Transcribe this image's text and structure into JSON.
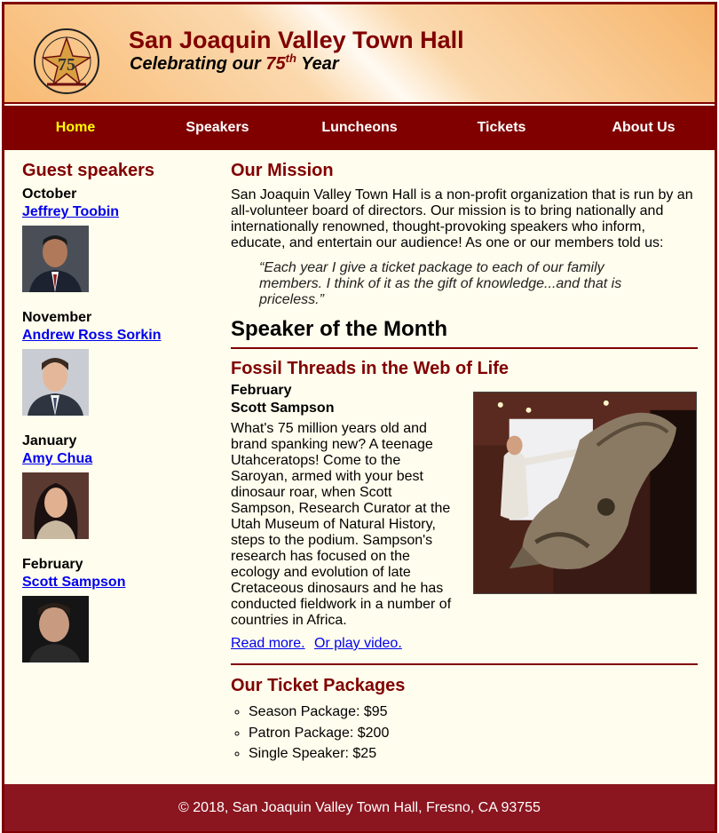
{
  "header": {
    "title": "San Joaquin Valley Town Hall",
    "tagline_prefix": "Celebrating our ",
    "tagline_number": "75",
    "tagline_sup": "th",
    "tagline_suffix": " Year"
  },
  "nav": {
    "items": [
      {
        "label": "Home"
      },
      {
        "label": "Speakers"
      },
      {
        "label": "Luncheons"
      },
      {
        "label": "Tickets"
      },
      {
        "label": "About Us"
      }
    ],
    "current": "Home"
  },
  "sidebar": {
    "heading": "Guest speakers",
    "speakers": [
      {
        "month": "October",
        "name": "Jeffrey Toobin"
      },
      {
        "month": "November",
        "name": "Andrew Ross Sorkin"
      },
      {
        "month": "January",
        "name": "Amy Chua"
      },
      {
        "month": "February",
        "name": "Scott Sampson"
      }
    ]
  },
  "mission": {
    "heading": "Our Mission",
    "text": "San Joaquin Valley Town Hall is a non-profit organization that is run by an all-volunteer board of directors. Our mission is to bring nationally and internationally renowned, thought-provoking speakers who inform, educate, and entertain our audience! As one or our members told us:",
    "quote": "“Each year I give a ticket package to each of our family members. I think of it as the gift of knowledge...and that is priceless.”"
  },
  "speaker_of_month": {
    "heading": "Speaker of the Month",
    "title": "Fossil Threads in the Web of Life",
    "month": "February",
    "name": "Scott Sampson",
    "text": "What's 75 million years old and brand spanking new? A teenage Utahceratops! Come to the Saroyan, armed with your best dinosaur roar, when Scott Sampson, Research Curator at the Utah Museum of Natural History, steps to the podium. Sampson's research has focused on the ecology and evolution of late Cretaceous dinosaurs and he has conducted fieldwork in a number of countries in Africa.",
    "read_more": "Read more.",
    "play_video": "Or play video."
  },
  "tickets": {
    "heading": "Our Ticket Packages",
    "items": [
      "Season Package: $95",
      "Patron Package: $200",
      "Single Speaker: $25"
    ]
  },
  "footer": {
    "text": "© 2018, San Joaquin Valley Town Hall, Fresno, CA 93755"
  },
  "colors": {
    "brand": "#800000",
    "nav_current": "#ffff00",
    "footer_bg": "#8b1620",
    "page_bg": "#fffded"
  }
}
